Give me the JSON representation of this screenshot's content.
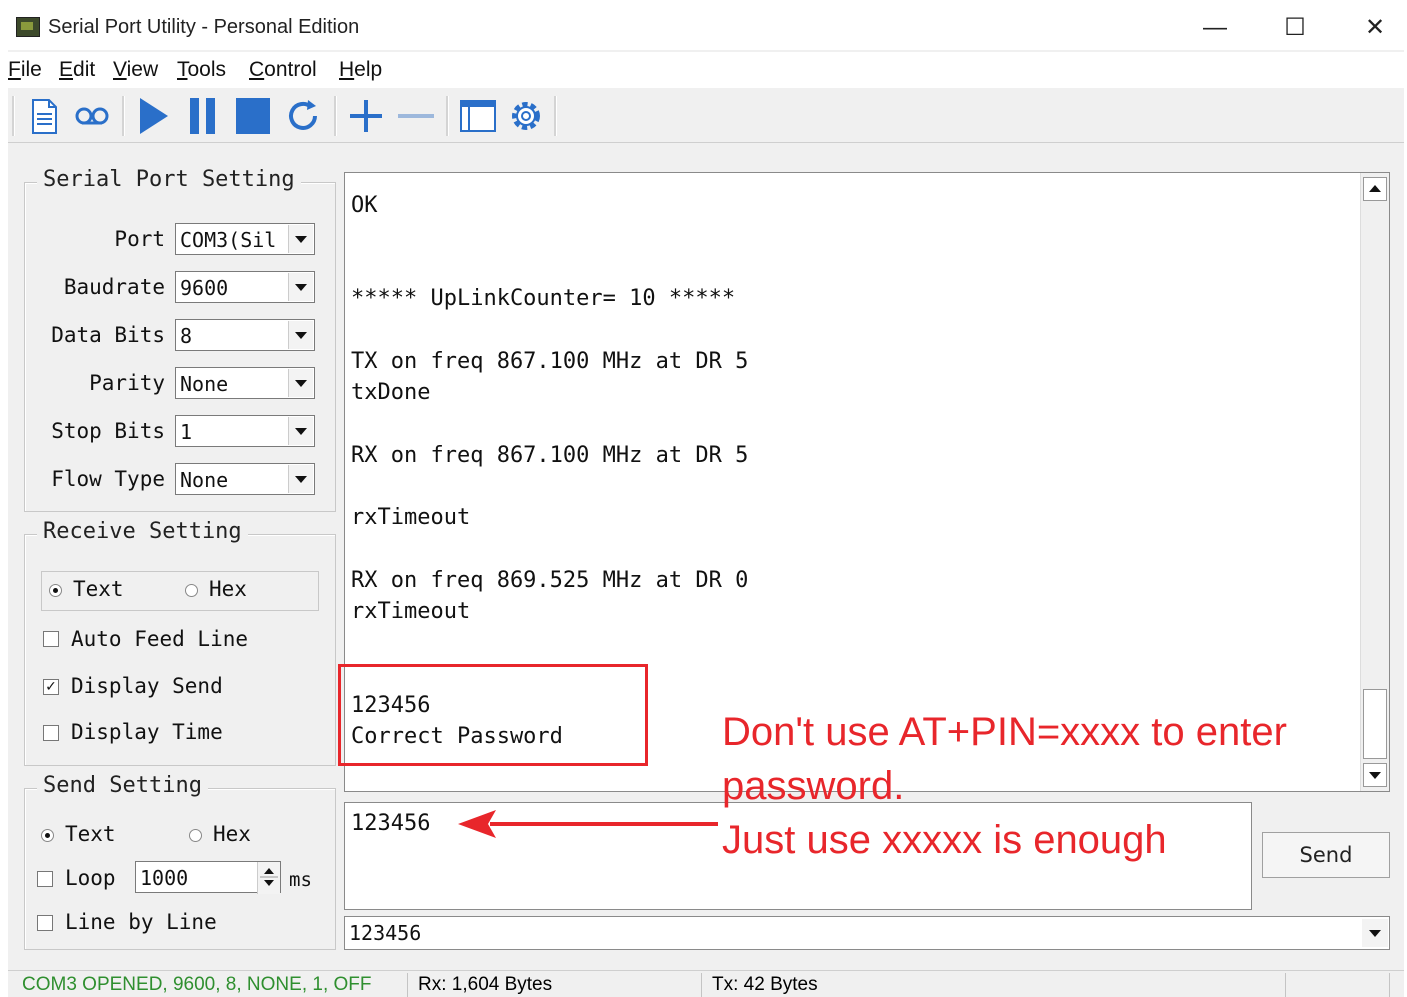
{
  "window": {
    "title": "Serial Port Utility - Personal Edition",
    "minimize": "—",
    "maximize": "☐",
    "close": "✕"
  },
  "menu": [
    {
      "first": "F",
      "rest": "ile"
    },
    {
      "first": "E",
      "rest": "dit"
    },
    {
      "first": "V",
      "rest": "iew"
    },
    {
      "first": "T",
      "rest": "ools"
    },
    {
      "first": "C",
      "rest": "ontrol"
    },
    {
      "first": "H",
      "rest": "elp"
    }
  ],
  "toolbar_icons": [
    "new-file-icon",
    "connect-icon",
    "start-icon",
    "pause-icon",
    "stop-icon",
    "refresh-icon",
    "add-icon",
    "remove-icon",
    "window-icon",
    "settings-icon"
  ],
  "serial_setting": {
    "title": "Serial Port Setting",
    "fields": [
      {
        "label": "Port",
        "value": "COM3(Sil"
      },
      {
        "label": "Baudrate",
        "value": "9600"
      },
      {
        "label": "Data Bits",
        "value": "8"
      },
      {
        "label": "Parity",
        "value": "None"
      },
      {
        "label": "Stop Bits",
        "value": "1"
      },
      {
        "label": "Flow Type",
        "value": "None"
      }
    ]
  },
  "receive_setting": {
    "title": "Receive Setting",
    "text_label": "Text",
    "hex_label": "Hex",
    "auto_feed": "Auto Feed Line",
    "display_send": "Display Send",
    "display_time": "Display Time",
    "text_selected": true,
    "auto_feed_checked": false,
    "display_send_checked": true,
    "display_time_checked": false
  },
  "send_setting": {
    "title": "Send Setting",
    "text_label": "Text",
    "hex_label": "Hex",
    "loop_label": "Loop",
    "loop_value": "1000",
    "ms_label": "ms",
    "line_by_line": "Line by Line",
    "text_selected": true
  },
  "receive_lines": [
    "OK",
    "***** UpLinkCounter= 10 *****",
    "TX on freq 867.100 MHz at DR 5",
    "txDone",
    "RX on freq 867.100 MHz at DR 5",
    "rxTimeout",
    "RX on freq 869.525 MHz at DR 0",
    "rxTimeout",
    "123456",
    "Correct Password"
  ],
  "annotation": {
    "line1": "Don't use AT+PIN=xxxx to enter",
    "line2": "password.",
    "line3": "Just use xxxxx is enough",
    "color": "#e8262b"
  },
  "send": {
    "text": "123456",
    "button": "Send",
    "history_value": "123456"
  },
  "status": {
    "port": "COM3 OPENED, 9600, 8, NONE, 1, OFF",
    "rx": "Rx: 1,604 Bytes",
    "tx": "Tx: 42 Bytes"
  }
}
